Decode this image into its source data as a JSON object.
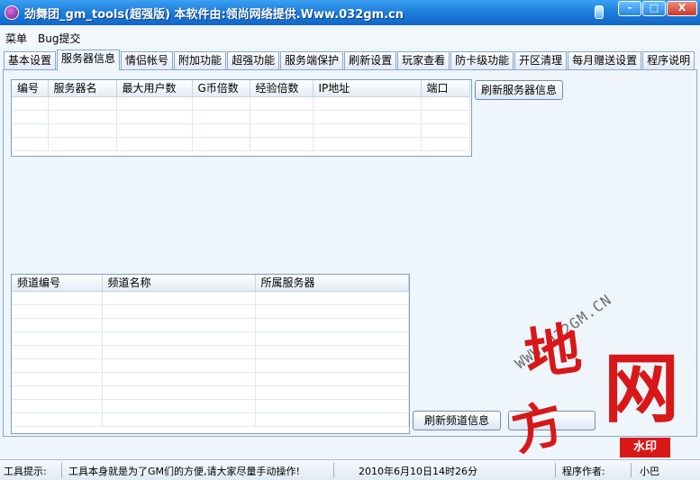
{
  "window": {
    "title": "劲舞团_gm_tools(超强版) 本软件由:领尚网络提供.Www.032gm.cn",
    "min_label": "–",
    "max_label": "□",
    "close_label": "X"
  },
  "menu": {
    "items": [
      "菜单",
      "Bug提交"
    ]
  },
  "tabs": [
    {
      "label": "基本设置"
    },
    {
      "label": "服务器信息",
      "active": true
    },
    {
      "label": "情侣帐号"
    },
    {
      "label": "附加功能"
    },
    {
      "label": "超强功能"
    },
    {
      "label": "服务端保护"
    },
    {
      "label": "刷新设置"
    },
    {
      "label": "玩家查看"
    },
    {
      "label": "防卡级功能"
    },
    {
      "label": "开区清理"
    },
    {
      "label": "每月赠送设置"
    },
    {
      "label": "程序说明"
    }
  ],
  "server_table": {
    "columns": [
      "编号",
      "服务器名",
      "最大用户数",
      "G币倍数",
      "经验倍数",
      "IP地址",
      "端口"
    ],
    "rows": []
  },
  "refresh_server_button": "刷新服务器信息",
  "channel_table": {
    "columns": [
      "频道编号",
      "频道名称",
      "所属服务器"
    ],
    "rows": []
  },
  "refresh_channel_button": "刷新频道信息",
  "status": {
    "tip_label": "工具提示:",
    "tip_text": "工具本身就是为了GM们的方便,请大家尽量手动操作!",
    "datetime": "2010年6月10日14时26分",
    "author_label": "程序作者:",
    "author": "小巴"
  },
  "watermark": {
    "url": "WWW.032GM.CN",
    "char1": "地",
    "char2": "方",
    "char3": "网",
    "badge": "水印"
  }
}
